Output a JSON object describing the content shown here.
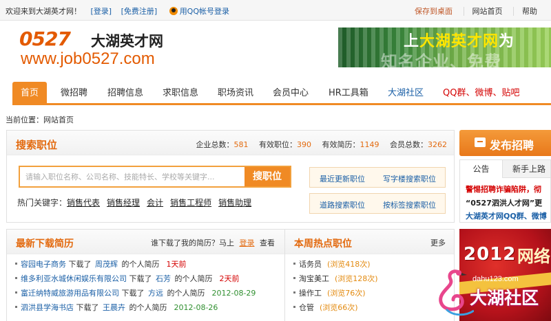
{
  "topbar": {
    "welcome": "欢迎来到大湖英才网！",
    "login": "[登录]",
    "register": "[免费注册]",
    "qq_login": "用QQ帐号登录",
    "save_desktop": "保存到桌面",
    "home": "网站首页",
    "help": "帮助"
  },
  "logo": {
    "number": "0527",
    "name": "大湖英才网",
    "url": "www.job0527.com"
  },
  "banner": {
    "slogan_prefix": "上",
    "slogan_highlight": "大湖英才网",
    "slogan_suffix": "为",
    "slogan_line2": "知名企业、免费"
  },
  "nav": {
    "items": [
      "首页",
      "微招聘",
      "招聘信息",
      "求职信息",
      "职场资讯",
      "会员中心",
      "HR工具箱",
      "大湖社区",
      "QQ群、微博、贴吧"
    ]
  },
  "breadcrumb": "当前位置：网站首页",
  "search": {
    "title": "搜索职位",
    "stats": {
      "company_label": "企业总数：",
      "company": "581",
      "jobs_label": "有效职位：",
      "jobs": "390",
      "resumes_label": "有效简历：",
      "resumes": "1149",
      "members_label": "会员总数：",
      "members": "3262"
    },
    "placeholder": "请输入职位名称、公司名称、技能特长、学校等关键字...",
    "button": "搜职位",
    "hot_label": "热门关键字：",
    "hot_keywords": [
      "销售代表",
      "销售经理",
      "会计",
      "销售工程师",
      "销售助理"
    ],
    "quick": [
      "最近更新职位",
      "写字楼搜索职位",
      "道路搜索职位",
      "按标签搜索职位"
    ]
  },
  "downloads": {
    "title": "最新下载简历",
    "prompt": "谁下载了我的简历？马上",
    "login": "登录",
    "view": "查看",
    "rows": [
      {
        "company": "容园电子商务",
        "verb": "下载了",
        "person": "周茂辉",
        "suffix": "的个人简历",
        "time": "1天前"
      },
      {
        "company": "维多利亚水城休闲娱乐有限公司",
        "verb": "下载了",
        "person": "石芳",
        "suffix": "的个人简历",
        "time": "2天前"
      },
      {
        "company": "富迁纳特威旅游用品有限公司",
        "verb": "下载了",
        "person": "方远",
        "suffix": "的个人简历",
        "time": "2012-08-29"
      },
      {
        "company": "泗洪县学海书店",
        "verb": "下载了",
        "person": "王晨卉",
        "suffix": "的个人简历",
        "time": "2012-08-26"
      }
    ]
  },
  "hotjobs": {
    "title": "本周热点职位",
    "more": "更多",
    "rows": [
      {
        "job": "话务员",
        "views": "(浏览418次)"
      },
      {
        "job": "淘宝美工",
        "views": "(浏览128次)"
      },
      {
        "job": "操作工",
        "views": "(浏览76次)"
      },
      {
        "job": "仓管",
        "views": "(浏览66次)"
      }
    ]
  },
  "sidebar": {
    "post_button": "发布招聘",
    "tabs": [
      "公告",
      "新手上路"
    ],
    "notices": [
      "警惕招聘诈骗陷阱，彻",
      "“0527泗洪人才网”更",
      "大湖英才网QQ群、微博"
    ],
    "ad_year": "2012",
    "ad_text": "网络"
  },
  "watermark": {
    "site": "dahu123.com",
    "name": "大湖社区"
  },
  "colors": {
    "accent": "#f08a24",
    "title_orange": "#e36a0f",
    "link_blue": "#1a5fa6",
    "alert_red": "#d40000"
  }
}
